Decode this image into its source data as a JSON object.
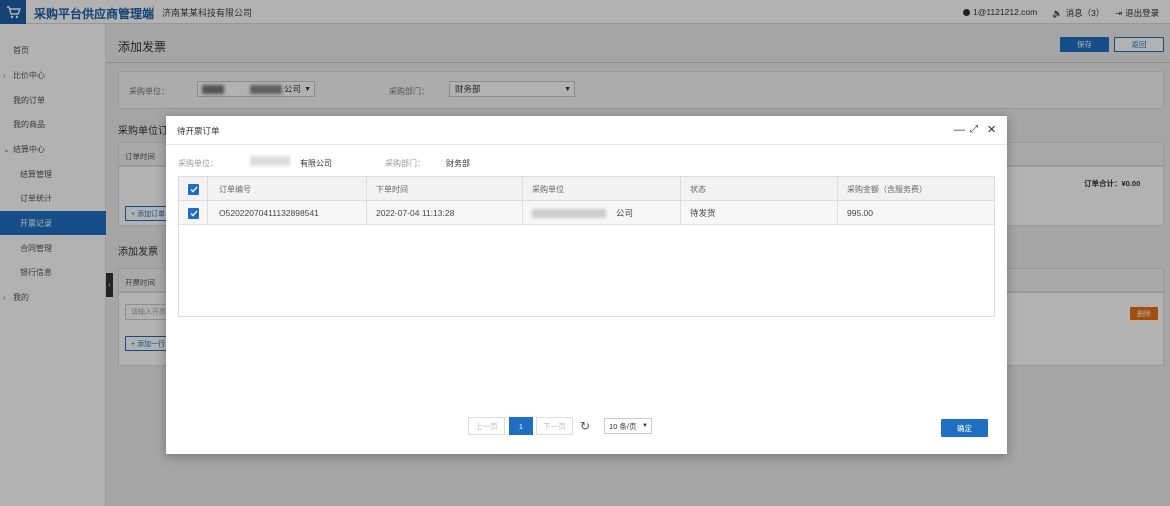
{
  "header": {
    "app_title": "采购平台供应商管理端",
    "company": "济南某某科技有限公司",
    "user": "1@1121212.com",
    "messages": "消息（3）",
    "logout": "退出登录"
  },
  "sidebar": {
    "items": [
      {
        "label": "首页"
      },
      {
        "label": "比价中心"
      },
      {
        "label": "我的订单"
      },
      {
        "label": "我的商品"
      },
      {
        "label": "结算中心"
      },
      {
        "label": "结算管理"
      },
      {
        "label": "订单统计"
      },
      {
        "label": "开票记录"
      },
      {
        "label": "合同管理"
      },
      {
        "label": "银行信息"
      },
      {
        "label": "我的"
      }
    ]
  },
  "page": {
    "title": "添加发票",
    "save_label": "保存",
    "back_label": "返回",
    "filter": {
      "unit_label": "采购单位：",
      "unit_value": "公司",
      "dept_label": "采购部门：",
      "dept_value": "财务部"
    },
    "section_order_title": "采购单位订",
    "order_table": {
      "header_first": "订单时间",
      "add_button": "+ 添加订单",
      "total": "订单合计：¥0.00"
    },
    "section_invoice_title": "添加发票",
    "invoice_table": {
      "header_first": "开票时间",
      "input_placeholder": "请输入开票",
      "add_button": "+ 添加一行",
      "delete_button": "删除"
    }
  },
  "modal": {
    "title": "待开票订单",
    "unit_label": "采购单位：",
    "unit_value": "有限公司",
    "dept_label": "采购部门：",
    "dept_value": "财务部",
    "columns": [
      "订单编号",
      "下单时间",
      "采购单位",
      "状态",
      "采购金额（含服务费）"
    ],
    "rows": [
      {
        "order_no": "O52022070411132898541",
        "order_time": "2022-07-04 11:13:28",
        "unit": "公司",
        "status": "待发货",
        "amount": "995.00"
      }
    ],
    "pager": {
      "prev": "上一页",
      "current": "1",
      "next": "下一页",
      "size": "10 条/页"
    },
    "confirm_label": "确定"
  }
}
